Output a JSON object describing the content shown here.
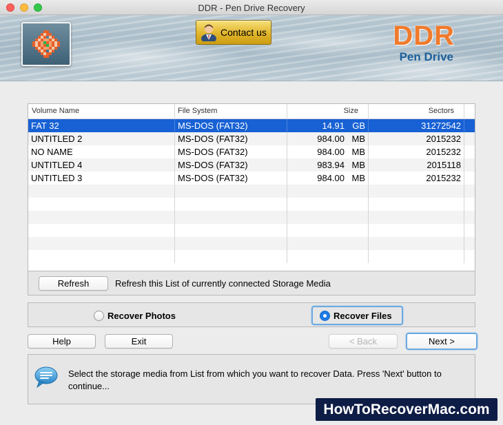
{
  "window": {
    "title": "DDR - Pen Drive Recovery"
  },
  "header": {
    "contact_label": "Contact us",
    "brand_name": "DDR",
    "brand_sub": "Pen Drive",
    "brand_color": "#f07a2c",
    "sub_color": "#1c5f9a"
  },
  "table": {
    "headers": [
      "Volume Name",
      "File System",
      "Size",
      "Sectors"
    ],
    "rows": [
      {
        "name": "FAT 32",
        "fs": "MS-DOS (FAT32)",
        "size": "14.91",
        "unit": "GB",
        "sectors": "31272542",
        "selected": true
      },
      {
        "name": "UNTITLED 2",
        "fs": "MS-DOS (FAT32)",
        "size": "984.00",
        "unit": "MB",
        "sectors": "2015232"
      },
      {
        "name": "NO NAME",
        "fs": "MS-DOS (FAT32)",
        "size": "984.00",
        "unit": "MB",
        "sectors": "2015232"
      },
      {
        "name": "UNTITLED 4",
        "fs": "MS-DOS (FAT32)",
        "size": "983.94",
        "unit": "MB",
        "sectors": "2015118"
      },
      {
        "name": "UNTITLED 3",
        "fs": "MS-DOS (FAT32)",
        "size": "984.00",
        "unit": "MB",
        "sectors": "2015232"
      }
    ],
    "selection_color": "#1861d4"
  },
  "refresh": {
    "button_label": "Refresh",
    "description": "Refresh this List of currently connected Storage Media"
  },
  "recover_options": {
    "photos_label": "Recover Photos",
    "files_label": "Recover Files",
    "selected": "files"
  },
  "actions": {
    "help_label": "Help",
    "exit_label": "Exit",
    "back_label": "< Back",
    "next_label": "Next >"
  },
  "message": {
    "icon": "speech-bubble-icon",
    "text": "Select the storage media from List from which you want to recover Data. Press 'Next' button to continue..."
  },
  "watermark": {
    "text": "HowToRecoverMac.com",
    "bg_color": "#0e1d45"
  }
}
